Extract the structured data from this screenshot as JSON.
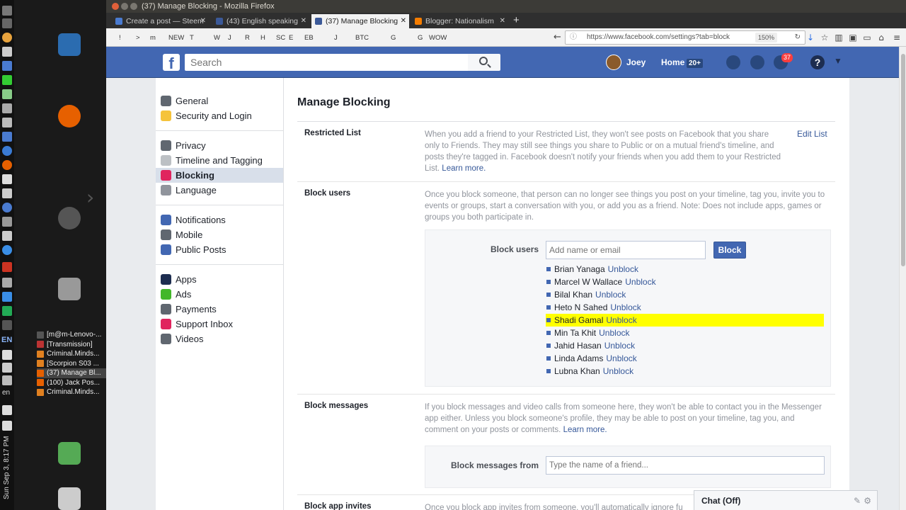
{
  "window": {
    "title": "(37) Manage Blocking - Mozilla Firefox"
  },
  "tabs": [
    {
      "label": "Create a post — Steem",
      "color": "#4a7bd0"
    },
    {
      "label": "(43) English speaking",
      "color": "#3b5998"
    },
    {
      "label": "(37) Manage Blocking",
      "color": "#3b5998"
    },
    {
      "label": "Blogger: Nationalism",
      "color": "#f57d00"
    }
  ],
  "bookmarks": [
    "!",
    ">",
    "m",
    "NEW",
    "T",
    "W",
    "J",
    "R",
    "H",
    "SC",
    "E",
    "EB",
    "J",
    "BTC",
    "G",
    "G",
    "WOW"
  ],
  "url": {
    "text": "https://www.facebook.com/settings?tab=block",
    "zoom": "150%"
  },
  "launcher": {
    "tasks": [
      {
        "label": "[m@m-Lenovo-...",
        "color": "#555"
      },
      {
        "label": "[Transmission]",
        "color": "#b33"
      },
      {
        "label": "Criminal.Minds...",
        "color": "#e08020"
      },
      {
        "label": "[Scorpion S03 ...",
        "color": "#e08020"
      },
      {
        "label": "(37) Manage Bl...",
        "color": "#e66000"
      },
      {
        "label": "(100) Jack Pos...",
        "color": "#e66000"
      },
      {
        "label": "Criminal.Minds...",
        "color": "#e08020"
      }
    ],
    "kb_lang": "EN",
    "lang": "en",
    "clock": "Sun Sep 3, 8:17 PM"
  },
  "fb_header": {
    "logo": "f",
    "search_placeholder": "Search",
    "user": "Joey",
    "home": "Home",
    "home_badge": "20+",
    "notif_count": "37",
    "help": "?"
  },
  "nav": {
    "groups": [
      [
        {
          "label": "General",
          "icon": "gear-icon",
          "color": "#606770"
        },
        {
          "label": "Security and Login",
          "icon": "badge-icon",
          "color": "#f5c33b"
        }
      ],
      [
        {
          "label": "Privacy",
          "icon": "lock-icon",
          "color": "#606770"
        },
        {
          "label": "Timeline and Tagging",
          "icon": "timeline-icon",
          "color": "#bcc0c4"
        },
        {
          "label": "Blocking",
          "icon": "block-icon",
          "color": "#e0245e"
        },
        {
          "label": "Language",
          "icon": "language-icon",
          "color": "#90949c"
        }
      ],
      [
        {
          "label": "Notifications",
          "icon": "globe-icon",
          "color": "#4267b2"
        },
        {
          "label": "Mobile",
          "icon": "mobile-icon",
          "color": "#606770"
        },
        {
          "label": "Public Posts",
          "icon": "rss-icon",
          "color": "#4267b2"
        }
      ],
      [
        {
          "label": "Apps",
          "icon": "apps-icon",
          "color": "#1d2d50"
        },
        {
          "label": "Ads",
          "icon": "ads-icon",
          "color": "#42b72a"
        },
        {
          "label": "Payments",
          "icon": "card-icon",
          "color": "#606770"
        },
        {
          "label": "Support Inbox",
          "icon": "lifebuoy-icon",
          "color": "#e0245e"
        },
        {
          "label": "Videos",
          "icon": "film-icon",
          "color": "#606770"
        }
      ]
    ]
  },
  "main": {
    "title": "Manage Blocking",
    "restricted": {
      "label": "Restricted List",
      "desc": "When you add a friend to your Restricted List, they won't see posts on Facebook that you share only to Friends. They may still see things you share to Public or on a mutual friend's timeline, and posts they're tagged in. Facebook doesn't notify your friends when you add them to your Restricted List.",
      "learn_more": "Learn more.",
      "edit": "Edit List"
    },
    "block_users": {
      "label": "Block users",
      "desc": "Once you block someone, that person can no longer see things you post on your timeline, tag you, invite you to events or groups, start a conversation with you, or add you as a friend. Note: Does not include apps, games or groups you both participate in.",
      "field_label": "Block users",
      "placeholder": "Add name or email",
      "button": "Block",
      "unblock_label": "Unblock",
      "blocked": [
        "Brian Yanaga",
        "Marcel W Wallace",
        "Bilal Khan",
        "Heto N Sahed",
        "Shadi Gamal",
        "Min Ta Khit",
        "Jahid Hasan",
        "Linda Adams",
        "Lubna Khan"
      ],
      "highlighted": "Shadi Gamal"
    },
    "block_messages": {
      "label": "Block messages",
      "desc": "If you block messages and video calls from someone here, they won't be able to contact you in the Messenger app either. Unless you block someone's profile, they may be able to post on your timeline, tag you, and comment on your posts or comments.",
      "learn_more": "Learn more.",
      "field_label": "Block messages from",
      "placeholder": "Type the name of a friend..."
    },
    "block_app_invites": {
      "label": "Block app invites",
      "desc": "Once you block app invites from someone, you'll automatically ignore fu"
    }
  },
  "chat": {
    "label": "Chat (Off)"
  }
}
